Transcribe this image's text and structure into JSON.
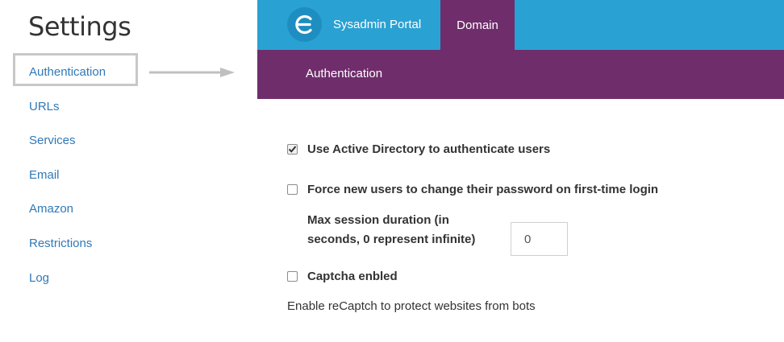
{
  "settings": {
    "title": "Settings",
    "items": [
      {
        "label": "Authentication"
      },
      {
        "label": "URLs"
      },
      {
        "label": "Services"
      },
      {
        "label": "Email"
      },
      {
        "label": "Amazon"
      },
      {
        "label": "Restrictions"
      },
      {
        "label": "Log"
      }
    ]
  },
  "header": {
    "brand": "Sysadmin Portal",
    "active_tab": "Domain",
    "logo_icon": "logo-e-icon"
  },
  "subnav": {
    "label": "Authentication"
  },
  "form": {
    "use_ad": {
      "label": "Use Active Directory to authenticate users",
      "checked": true
    },
    "force_change": {
      "label": "Force new users to change their password on first-time login",
      "checked": false
    },
    "max_session": {
      "label": "Max session duration (in seconds, 0 represent infinite)",
      "value": "0"
    },
    "captcha": {
      "label": "Captcha enbled",
      "checked": false
    },
    "captcha_help": "Enable reCaptch to protect websites from bots"
  },
  "colors": {
    "topbar": "#2aa1d3",
    "purple": "#6f2d6b",
    "link": "#2f79b8"
  }
}
